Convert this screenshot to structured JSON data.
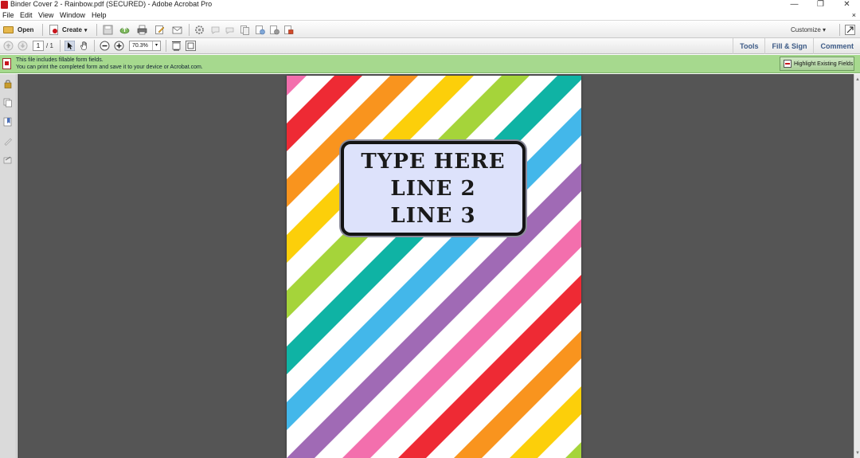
{
  "window": {
    "title": "Binder Cover 2 - Rainbow.pdf (SECURED) - Adobe Acrobat Pro",
    "controls": {
      "minimize": "—",
      "restore": "❐",
      "close": "✕"
    }
  },
  "menu": {
    "items": [
      "File",
      "Edit",
      "View",
      "Window",
      "Help"
    ],
    "close_doc": "×"
  },
  "toolbar": {
    "open_label": "Open",
    "create_label": "Create",
    "customize_label": "Customize"
  },
  "nav": {
    "page_current": "1",
    "page_total": "/ 1",
    "zoom_value": "70.3%"
  },
  "panel_links": {
    "tools": "Tools",
    "fill_sign": "Fill & Sign",
    "comment": "Comment"
  },
  "notice": {
    "line1": "This file includes fillable form fields.",
    "line2": "You can print the completed form and save it to your device or Acrobat.com.",
    "highlight_button": "Highlight Existing Fields"
  },
  "document": {
    "fields": [
      "TYPE HERE",
      "LINE 2",
      "LINE 3"
    ],
    "stripe_colors": [
      "#f36fad",
      "#ee2a34",
      "#f9941e",
      "#fccf0a",
      "#a5d43a",
      "#0fb3a4",
      "#43b7ea",
      "#a06ab5"
    ]
  }
}
